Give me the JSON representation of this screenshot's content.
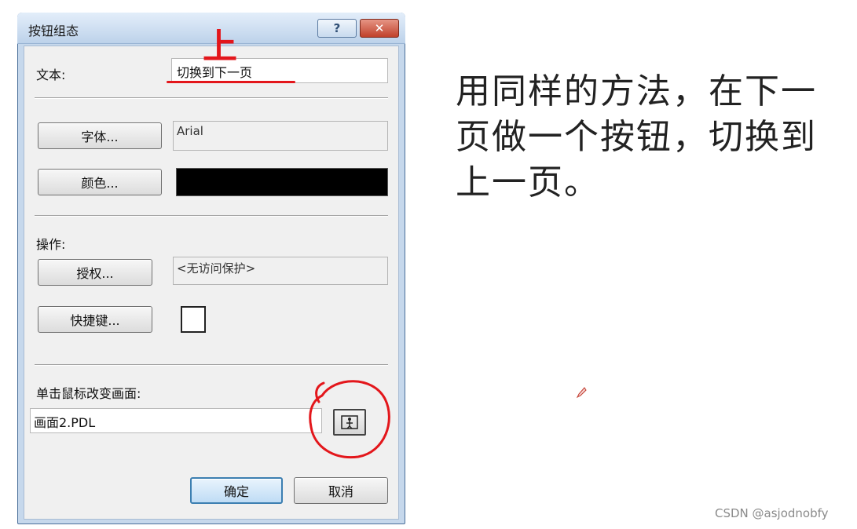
{
  "dialog": {
    "title": "按钮组态",
    "help_label": "?",
    "close_label": "✕"
  },
  "text_section": {
    "label": "文本:",
    "value": "切换到下一页",
    "annotation": "上"
  },
  "font": {
    "button_label": "字体...",
    "value": "Arial"
  },
  "color": {
    "button_label": "颜色...",
    "swatch": "#000000"
  },
  "operation": {
    "label": "操作:",
    "auth_button_label": "授权...",
    "auth_value": "<无访问保护>",
    "hotkey_button_label": "快捷键..."
  },
  "screen_change": {
    "label": "单击鼠标改变画面:",
    "value": "画面2.PDL"
  },
  "footer": {
    "ok_label": "确定",
    "cancel_label": "取消"
  },
  "note": {
    "text": "用同样的方法，在下一页做一个按钮，切换到上一页。"
  },
  "watermark": "CSDN @asjodnobfy",
  "colors": {
    "annotation_red": "#e3161b",
    "dialog_frame": "#c6d8ec",
    "client_bg": "#f0f0f0"
  },
  "icons": {
    "browse": "browse-screen-icon"
  }
}
